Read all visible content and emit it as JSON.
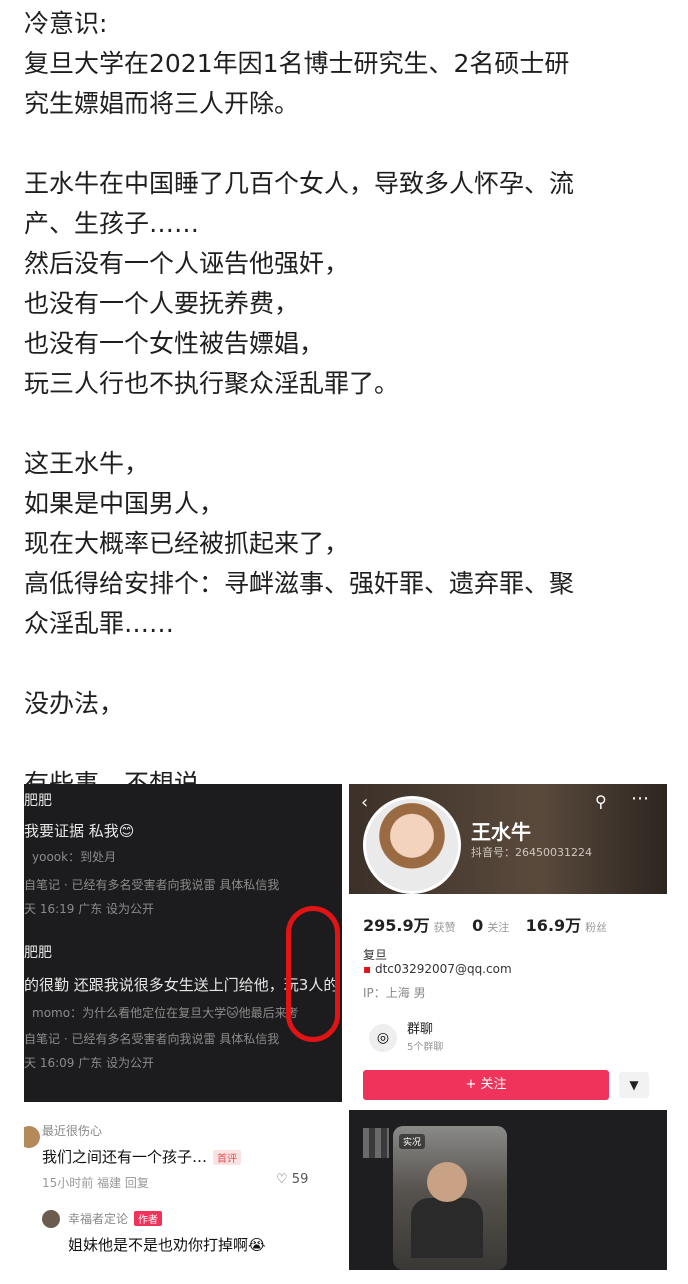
{
  "post": {
    "lines": [
      "冷意识:",
      "复旦大学在2021年因1名博士研究生、2名硕士研",
      "究生嫖娼而将三人开除。",
      "",
      "王水牛在中国睡了几百个女人，导致多人怀孕、流",
      "产、生孩子……",
      "然后没有一个人诬告他强奸，",
      "也没有一个人要抚养费，",
      "也没有一个女性被告嫖娼，",
      "玩三人行也不执行聚众淫乱罪了。",
      "",
      "这王水牛，",
      "如果是中国男人，",
      "现在大概率已经被抓起来了，",
      "高低得给安排个：寻衅滋事、强奸罪、遗弃罪、聚",
      "众淫乱罪……",
      "",
      "没办法，",
      "",
      "有些事，不想说。"
    ]
  },
  "comments_dark": {
    "lines": [
      "肥肥",
      "我要证据 私我😊",
      "yoook：到处月",
      "自笔记 · 已经有多名受害者向我说雷 具体私信我",
      "天 16:19 广东  设为公开",
      "肥肥",
      "的很勤 还跟我说很多女生送上门给他，玩3人的",
      "momo：为什么看他定位在复旦大学🐱他最后来考",
      "自笔记 · 已经有多名受害者向我说雷 具体私信我",
      "天 16:09 广东  设为公开"
    ]
  },
  "profile": {
    "name": "王水牛",
    "uid": "抖音号：26450031224",
    "likes_value": "295.9万",
    "likes_label": "获赞",
    "following_value": "0",
    "following_label": "关注",
    "fans_value": "16.9万",
    "fans_label": "粉丝",
    "school": "复旦",
    "email": "dtc03292007@qq.com",
    "location": "IP：上海   男",
    "group_title": "群聊",
    "group_sub": "5个群聊",
    "follow_button": "+ 关注",
    "dropdown": "▼"
  },
  "comments_light": {
    "c1_user": "最近很伤心",
    "c1_text": "我们之间还有一个孩子…",
    "c1_tag": "首评",
    "c1_meta": "15小时前   福建   回复",
    "c1_likes": "59",
    "c2_user": "幸福者定论",
    "c2_tag": "作者",
    "c2_text": "姐妹他是不是也劝你打掉啊😭"
  },
  "video": {
    "badge": "实况"
  },
  "icons": {
    "back": "chevron-left-icon",
    "search": "search-icon",
    "more": "more-icon",
    "heart": "heart-icon"
  },
  "colors": {
    "accent": "#f0335a",
    "highlight_circle": "#e01414"
  }
}
